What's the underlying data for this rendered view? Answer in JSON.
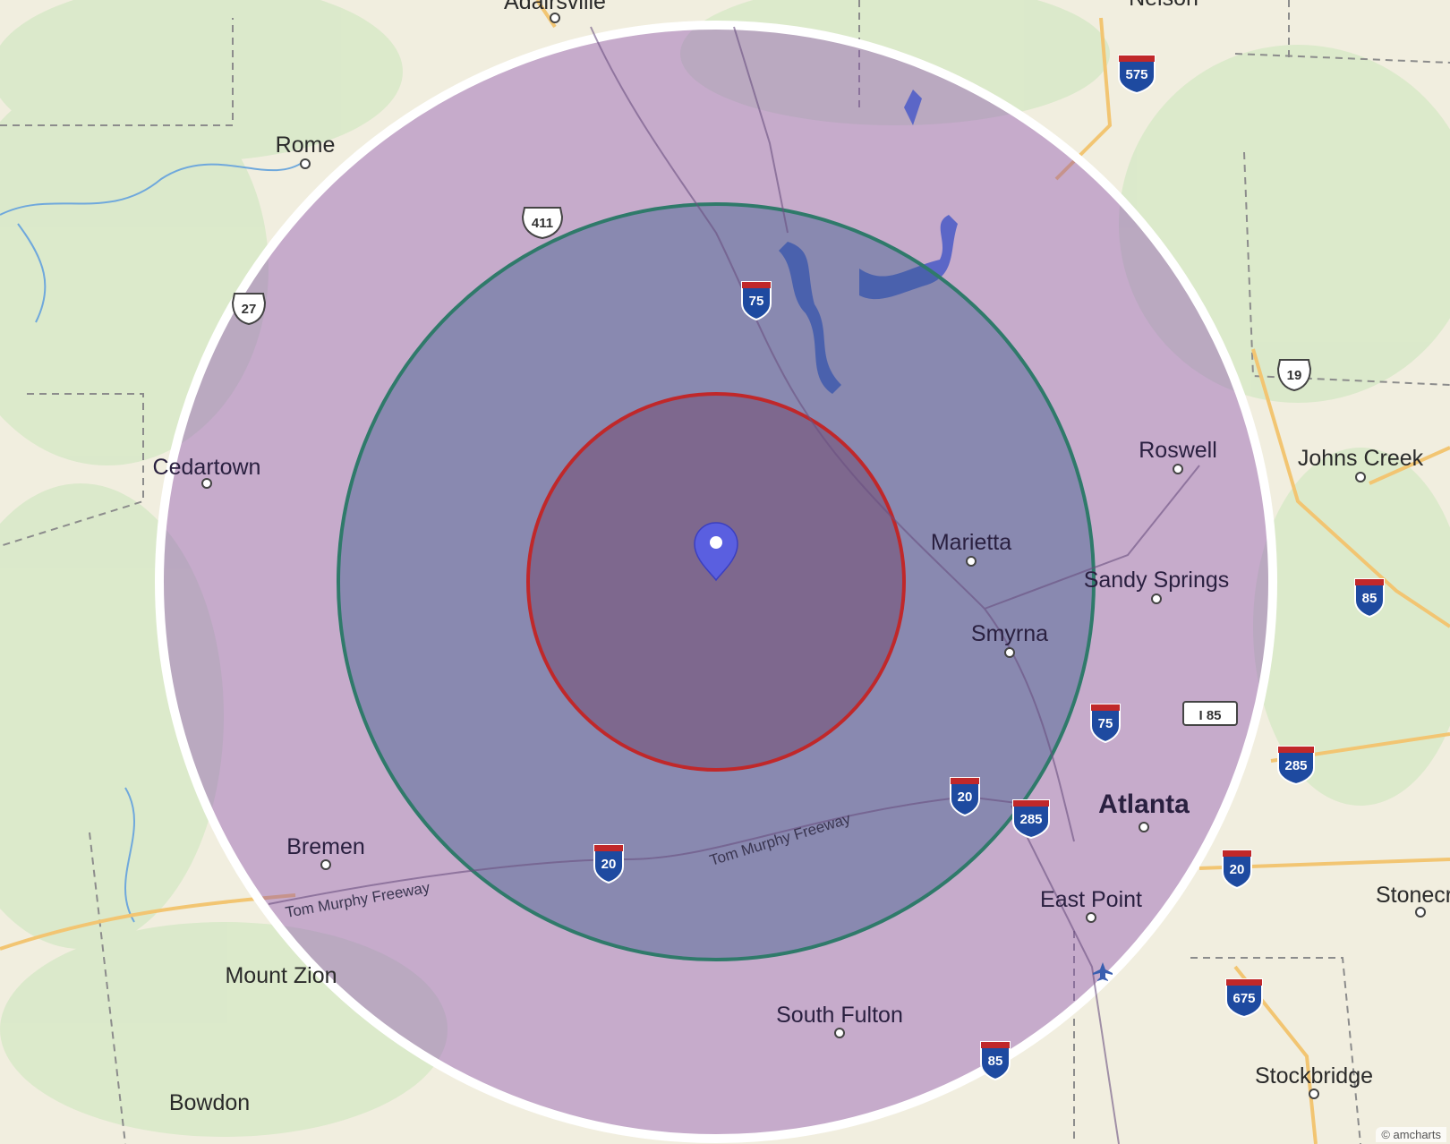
{
  "map": {
    "center_label": "",
    "places": [
      {
        "name": "Adairsville"
      },
      {
        "name": "Rome"
      },
      {
        "name": "Cedartown"
      },
      {
        "name": "Bremen"
      },
      {
        "name": "Mount Zion"
      },
      {
        "name": "Bowdon"
      },
      {
        "name": "Marietta"
      },
      {
        "name": "Smyrna"
      },
      {
        "name": "Roswell"
      },
      {
        "name": "Sandy Springs"
      },
      {
        "name": "Johns Creek"
      },
      {
        "name": "Atlanta"
      },
      {
        "name": "East Point"
      },
      {
        "name": "South Fulton"
      },
      {
        "name": "Stonecre"
      },
      {
        "name": "Stockbridge"
      },
      {
        "name": "Nelson"
      }
    ],
    "road_labels": [
      "Tom Murphy Freeway",
      "Tom Murphy Freeway"
    ],
    "shields": {
      "interstate": [
        "575",
        "75",
        "20",
        "20",
        "285",
        "75",
        "285",
        "20",
        "85",
        "675",
        "85"
      ],
      "us_highway": [
        "411",
        "27",
        "19"
      ],
      "boxed": [
        "I 85"
      ]
    },
    "radius_rings": [
      {
        "ring": "outer",
        "fill": "#8a4fb0",
        "stroke": "#ffffff"
      },
      {
        "ring": "middle",
        "fill": "#355a8a",
        "stroke": "#2f7a6a"
      },
      {
        "ring": "inner",
        "fill": "#6a2a50",
        "stroke": "#c0282a"
      }
    ],
    "marker": {
      "icon": "map-pin-icon",
      "color": "#5a5fe0"
    },
    "attribution": "© amcharts"
  }
}
